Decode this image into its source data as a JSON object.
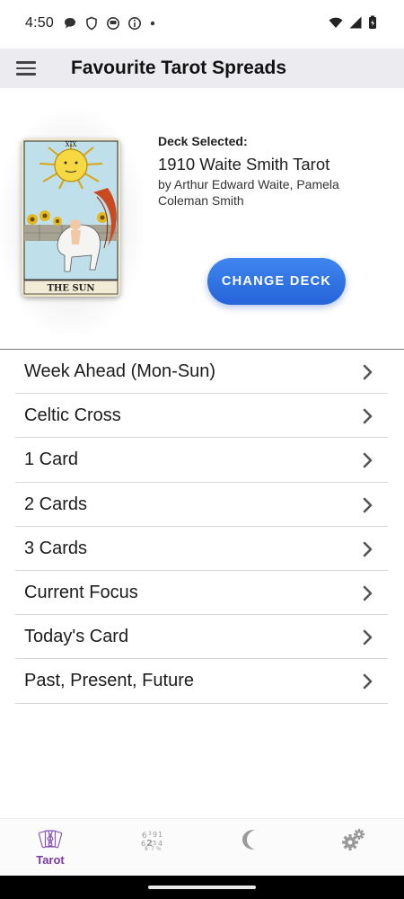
{
  "status_bar": {
    "time": "4:50",
    "icons_left": [
      "chat-bubble-icon",
      "shield-icon",
      "android-icon",
      "info-icon",
      "dot-icon"
    ],
    "icons_right": [
      "wifi-icon",
      "signal-icon",
      "battery-icon"
    ]
  },
  "app_bar": {
    "menu_icon": "hamburger-menu-icon",
    "title": "Favourite Tarot Spreads"
  },
  "deck": {
    "label": "Deck Selected:",
    "name": "1910 Waite Smith Tarot",
    "author": "by Arthur Edward Waite, Pamela Coleman Smith",
    "card_numeral": "XIX",
    "card_caption": "THE SUN",
    "change_button": "CHANGE DECK",
    "button_color": "#2f6fe4"
  },
  "spreads": [
    {
      "label": "Week Ahead (Mon-Sun)"
    },
    {
      "label": "Celtic Cross"
    },
    {
      "label": "1 Card"
    },
    {
      "label": "2 Cards"
    },
    {
      "label": "3 Cards"
    },
    {
      "label": "Current Focus"
    },
    {
      "label": "Today's Card"
    },
    {
      "label": "Past, Present, Future"
    }
  ],
  "bottom_nav": {
    "items": [
      {
        "icon": "tarot-cards-icon",
        "label": "Tarot",
        "active": true
      },
      {
        "icon": "numerology-icon",
        "label": "",
        "active": false
      },
      {
        "icon": "moon-icon",
        "label": "",
        "active": false
      },
      {
        "icon": "settings-gears-icon",
        "label": "",
        "active": false
      }
    ],
    "active_color": "#7b3aa6",
    "inactive_color": "#9a9a9a"
  }
}
